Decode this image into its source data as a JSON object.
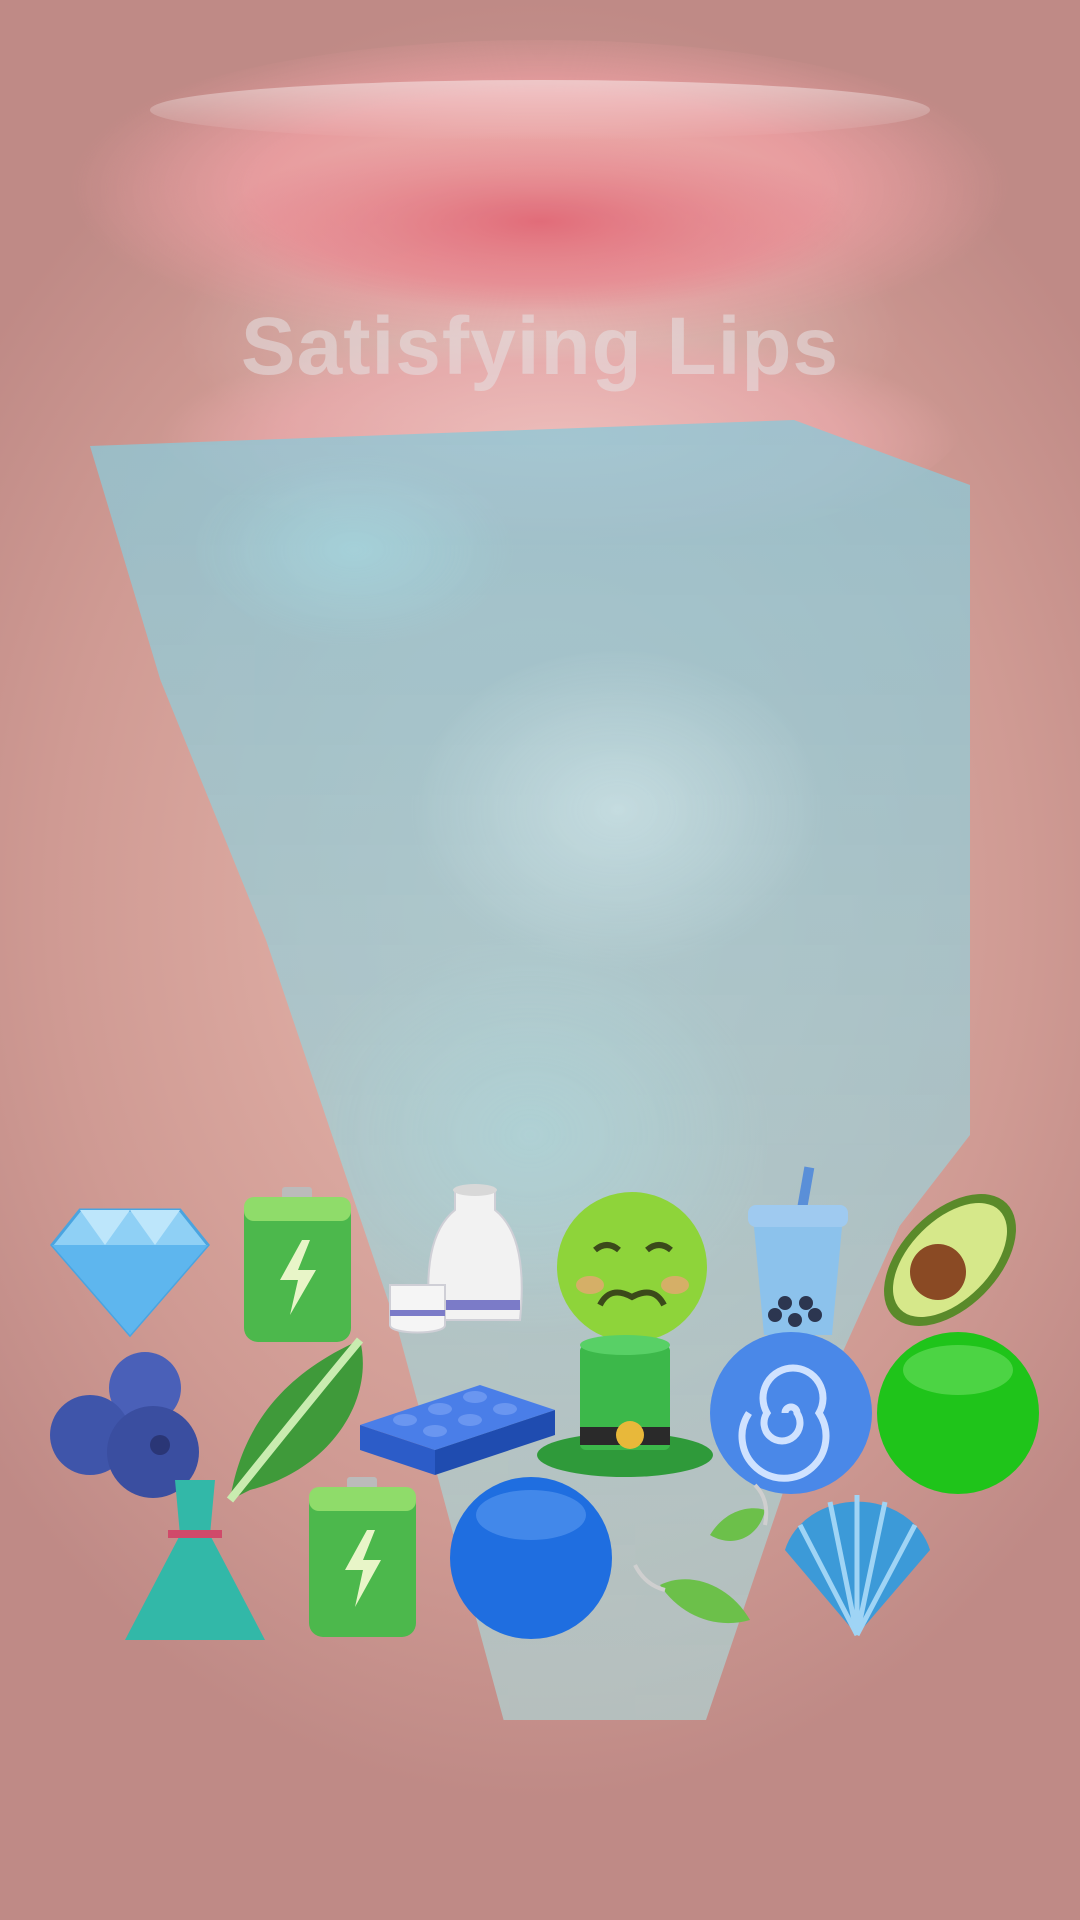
{
  "overlay": {
    "watermark_text": "Satisfying Lips"
  },
  "emojis": {
    "row1": [
      "gem-stone",
      "battery",
      "sake",
      "nauseated-face",
      "bubble-tea",
      "avocado"
    ],
    "row2": [
      "blueberries",
      "leafy-green",
      "building-block",
      "top-hat",
      "cyclone",
      "green-circle"
    ],
    "row3": [
      "dress",
      "battery",
      "blue-circle",
      "leaf-fluttering-in-wind",
      "spiral-shell"
    ]
  }
}
